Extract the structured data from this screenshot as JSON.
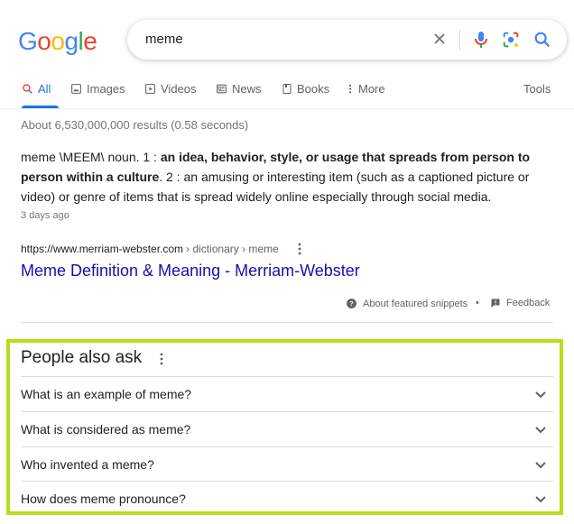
{
  "logo": {
    "letters": [
      "G",
      "o",
      "o",
      "g",
      "l",
      "e"
    ],
    "colors": [
      "#4285F4",
      "#EA4335",
      "#FBBC05",
      "#4285F4",
      "#34A853",
      "#EA4335"
    ]
  },
  "search": {
    "query": "meme"
  },
  "tabs": [
    {
      "label": "All",
      "icon": "search-icon",
      "active": true
    },
    {
      "label": "Images",
      "icon": "image-icon"
    },
    {
      "label": "Videos",
      "icon": "video-icon"
    },
    {
      "label": "News",
      "icon": "news-icon"
    },
    {
      "label": "Books",
      "icon": "book-icon"
    },
    {
      "label": "More",
      "icon": "more-vert-icon"
    }
  ],
  "tools_label": "Tools",
  "stats": "About 6,530,000,000 results (0.58 seconds)",
  "snippet": {
    "p1": "meme \\MEEM\\ noun. 1 : ",
    "b1": "an idea, behavior, style, or usage that spreads from person to person within a culture",
    "p2": ". 2 : an amusing or interesting item (such as a captioned picture or video) or genre of items that is spread widely online especially through social media.",
    "date": "3 days ago"
  },
  "result": {
    "url_host": "https://www.merriam-webster.com",
    "url_path": "› dictionary › meme",
    "title": "Meme Definition & Meaning - Merriam-Webster"
  },
  "footer": {
    "about": "About featured snippets",
    "dot": "•",
    "feedback": "Feedback"
  },
  "paa": {
    "title": "People also ask",
    "questions": [
      "What is an example of meme?",
      "What is considered as meme?",
      "Who invented a meme?",
      "How does meme pronounce?"
    ]
  },
  "colors": {
    "accent": "#1a73e8",
    "link": "#1a0dab",
    "highlight_border": "#b5df1b"
  }
}
